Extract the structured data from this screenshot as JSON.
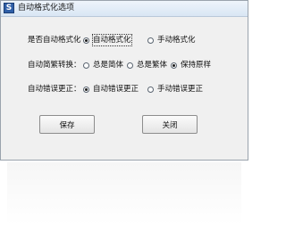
{
  "window": {
    "title": "自动格式化选项",
    "icon": "app-icon-s",
    "icon_glyph": "S"
  },
  "rows": [
    {
      "label": "是否自动格式化",
      "options": [
        {
          "label": "自动格式化",
          "checked": true
        },
        {
          "label": "手动格式化",
          "checked": false
        }
      ]
    },
    {
      "label": "自动简繁转换：",
      "options": [
        {
          "label": "总是简体",
          "checked": false
        },
        {
          "label": "总是繁体",
          "checked": false
        },
        {
          "label": "保持原样",
          "checked": true
        }
      ]
    },
    {
      "label": "自动错误更正：",
      "options": [
        {
          "label": "自动错误更正",
          "checked": true
        },
        {
          "label": "手动错误更正",
          "checked": false
        }
      ]
    }
  ],
  "buttons": {
    "save": "保存",
    "close": "关闭"
  },
  "colors": {
    "title_bar": "#d9e6f4",
    "window_bg": "#f0f0f0",
    "icon_bg": "#2f5fa8"
  }
}
